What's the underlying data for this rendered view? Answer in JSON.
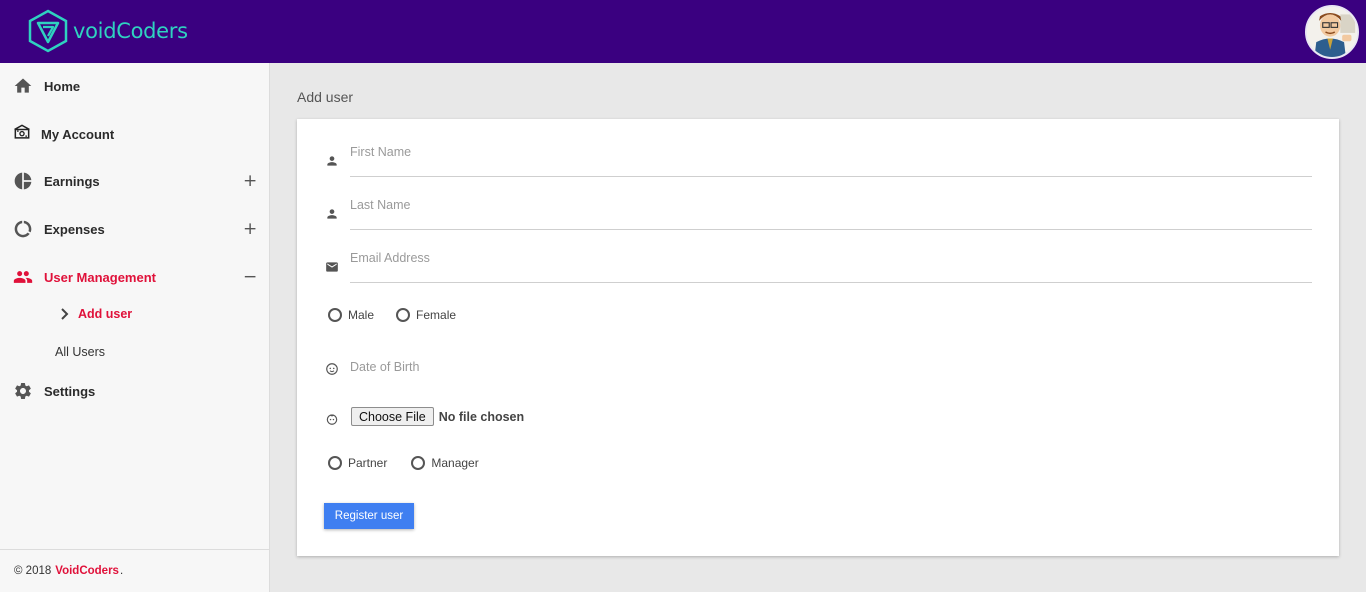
{
  "header": {
    "brand_name": "voidCoders",
    "brand_color": "#2fd2c0",
    "bar_color": "#3a0080",
    "avatar_icon": "user-avatar-cartoon"
  },
  "sidebar": {
    "items": [
      {
        "label": "Home",
        "icon": "home-icon",
        "toggle": ""
      },
      {
        "label": "My Account",
        "icon": "account-icon",
        "toggle": ""
      },
      {
        "label": "Earnings",
        "icon": "pie-chart-icon",
        "toggle": "+"
      },
      {
        "label": "Expenses",
        "icon": "donut-chart-icon",
        "toggle": "+"
      },
      {
        "label": "User Management",
        "icon": "people-icon",
        "toggle": "−",
        "active": true
      },
      {
        "label": "Settings",
        "icon": "gear-icon",
        "toggle": ""
      }
    ],
    "sub_items": [
      {
        "label": "Add user",
        "active": true
      },
      {
        "label": "All Users",
        "active": false
      }
    ],
    "footer": {
      "prefix": "© 2018",
      "brand": "VoidCoders",
      "suffix": "."
    },
    "active_color": "#e0113a"
  },
  "main": {
    "page_title": "Add user",
    "form": {
      "first_name_placeholder": "First Name",
      "last_name_placeholder": "Last Name",
      "email_placeholder": "Email Address",
      "gender_options": [
        "Male",
        "Female"
      ],
      "dob_placeholder": "Date of Birth",
      "file_button": "Choose File",
      "file_status": "No file chosen",
      "role_options": [
        "Partner",
        "Manager"
      ],
      "submit_label": "Register user",
      "submit_color": "#3f7ff1"
    }
  }
}
